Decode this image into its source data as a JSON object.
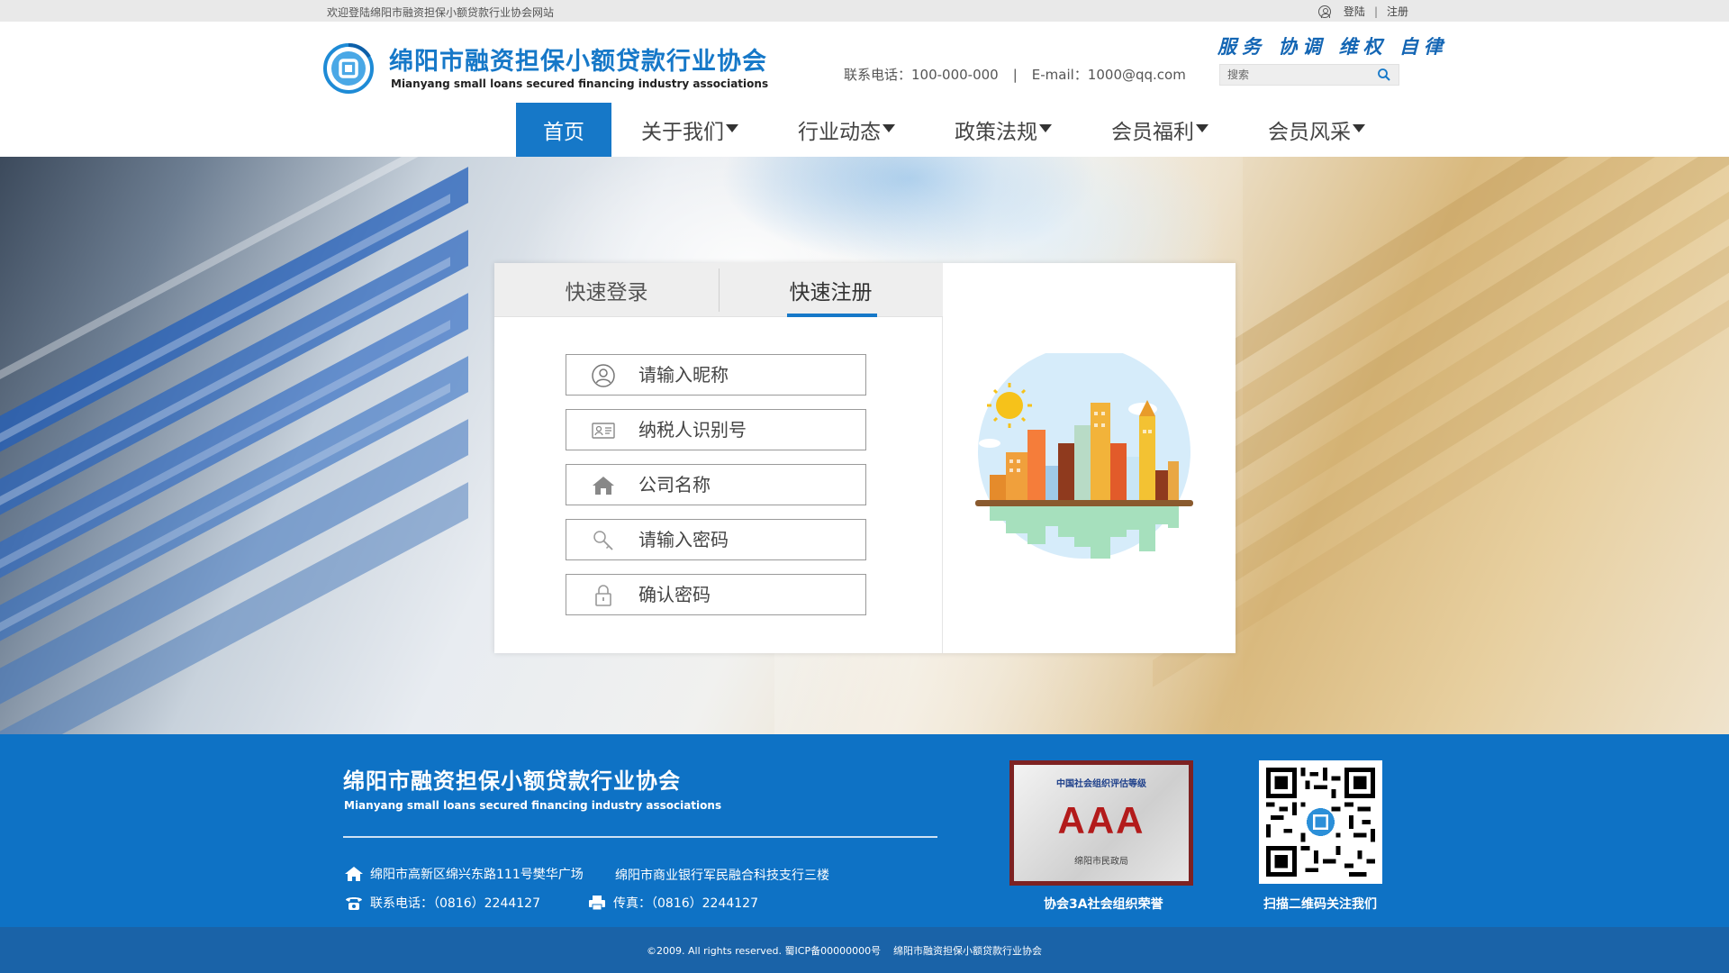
{
  "topbar": {
    "welcome": "欢迎登陆绵阳市融资担保小额贷款行业协会网站",
    "login": "登陆",
    "separator": "|",
    "register": "注册"
  },
  "header": {
    "org_name_cn": "绵阳市融资担保小额贷款行业协会",
    "org_name_en": "Mianyang small loans secured financing industry associations",
    "slogan": "服务 协调 维权 自律",
    "phone": "联系电话：100-000-000",
    "email": "E-mail：1000@qq.com",
    "contact_sep": "|",
    "search_placeholder": "搜索"
  },
  "nav": {
    "items": [
      {
        "label": "首页",
        "active": true
      },
      {
        "label": "关于我们"
      },
      {
        "label": "行业动态"
      },
      {
        "label": "政策法规"
      },
      {
        "label": "会员福利"
      },
      {
        "label": "会员风采"
      }
    ]
  },
  "form": {
    "tab_login": "快速登录",
    "tab_register": "快速注册",
    "fields": [
      {
        "placeholder": "请输入昵称",
        "icon": "user-icon"
      },
      {
        "placeholder": "纳税人识别号",
        "icon": "id-card-icon"
      },
      {
        "placeholder": "公司名称",
        "icon": "house-icon"
      },
      {
        "placeholder": "请输入密码",
        "icon": "key-icon"
      },
      {
        "placeholder": "确认密码",
        "icon": "lock-icon"
      }
    ]
  },
  "footer": {
    "org_name_cn": "绵阳市融资担保小额贷款行业协会",
    "org_name_en": "Mianyang small loans secured financing industry associations",
    "address": "绵阳市高新区绵兴东路111号樊华广场",
    "address2": "绵阳市商业银行军民融合科技支行三楼",
    "phone": "联系电话：（0816）2244127",
    "fax": "传真：（0816）2244127",
    "cert_title": "中国社会组织评估等级",
    "cert_grade": "AAA",
    "cert_issuer": "绵阳市民政局",
    "cert_caption": "协会3A社会组织荣誉",
    "qr_caption": "扫描二维码关注我们",
    "copyright": "©2009. All rights reserved. 蜀ICP备00000000号",
    "copyright_org": "绵阳市融资担保小额贷款行业协会"
  },
  "colors": {
    "brand_blue": "#1678c8",
    "footer_blue": "#0e72c5",
    "bottom_bar": "#1a63a8"
  }
}
